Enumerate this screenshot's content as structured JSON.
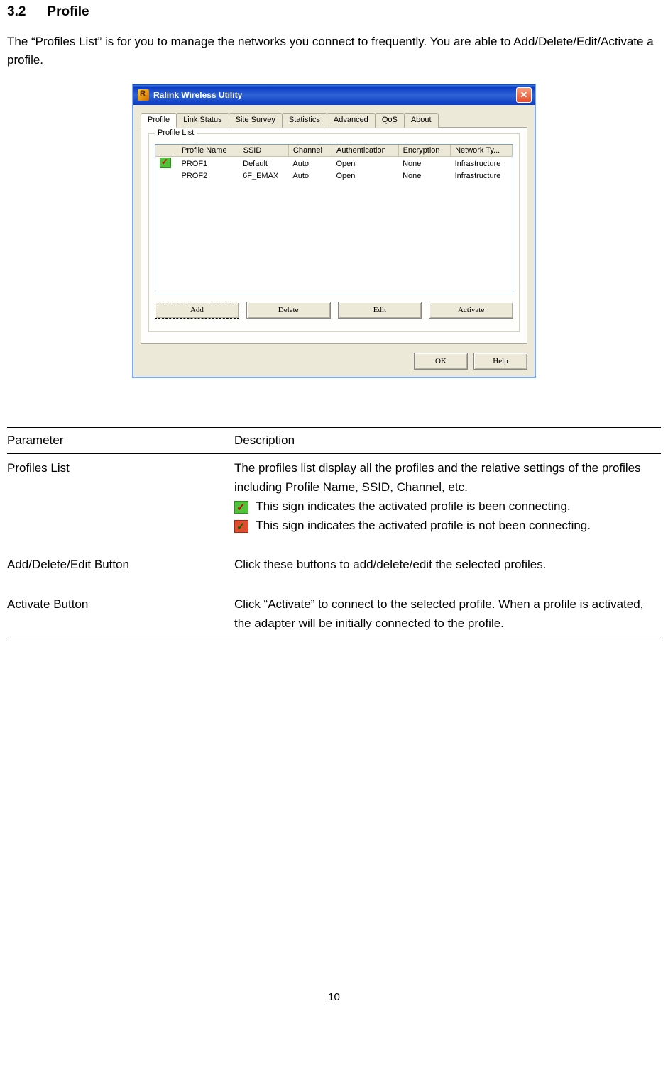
{
  "section": {
    "number": "3.2",
    "title": "Profile"
  },
  "intro": "The “Profiles List” is for you to manage the networks you connect to frequently. You are able to Add/Delete/Edit/Activate a profile.",
  "window": {
    "title": "Ralink Wireless Utility",
    "tabs": [
      "Profile",
      "Link Status",
      "Site Survey",
      "Statistics",
      "Advanced",
      "QoS",
      "About"
    ],
    "groupbox": "Profile List",
    "columns": [
      "Profile Name",
      "SSID",
      "Channel",
      "Authentication",
      "Encryption",
      "Network Ty..."
    ],
    "rows": [
      {
        "status": "active",
        "profile": "PROF1",
        "ssid": "Default",
        "channel": "Auto",
        "auth": "Open",
        "enc": "None",
        "net": "Infrastructure"
      },
      {
        "status": "",
        "profile": "PROF2",
        "ssid": "6F_EMAX",
        "channel": "Auto",
        "auth": "Open",
        "enc": "None",
        "net": "Infrastructure"
      }
    ],
    "buttons": {
      "add": "Add",
      "delete": "Delete",
      "edit": "Edit",
      "activate": "Activate",
      "ok": "OK",
      "help": "Help"
    }
  },
  "table": {
    "head_param": "Parameter",
    "head_desc": "Description",
    "rows": [
      {
        "param": "Profiles List",
        "desc_pre": "The profiles list display all the profiles and the relative settings of the profiles including Profile Name, SSID, Channel, etc.",
        "icon1_desc": "This sign indicates the activated profile is been connecting.",
        "icon2_desc": "This sign indicates the activated profile is not been connecting."
      },
      {
        "param": "Add/Delete/Edit Button",
        "desc": "Click these buttons to add/delete/edit the selected profiles."
      },
      {
        "param": "Activate Button",
        "desc": "Click “Activate” to connect to the selected profile. When a profile is activated, the adapter will be initially connected to the profile."
      }
    ]
  },
  "page_number": "10"
}
